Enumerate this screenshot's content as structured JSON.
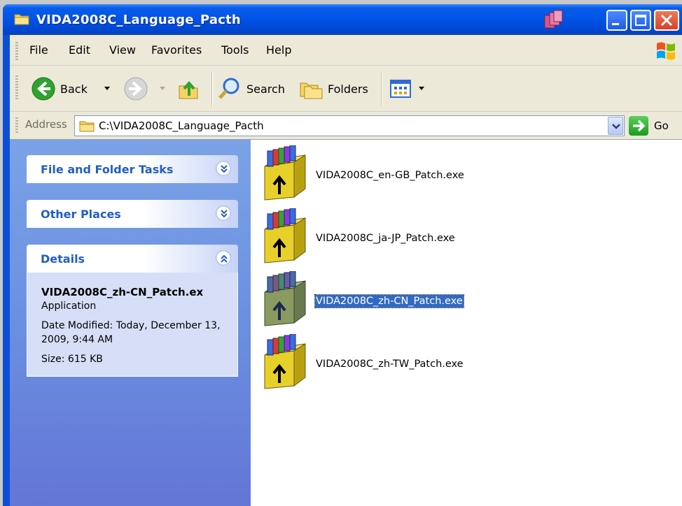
{
  "window": {
    "title": "VIDA2008C_Language_Pacth"
  },
  "menu": [
    "File",
    "Edit",
    "View",
    "Favorites",
    "Tools",
    "Help"
  ],
  "toolbar": {
    "back_label": "Back",
    "search_label": "Search",
    "folders_label": "Folders"
  },
  "address": {
    "label": "Address",
    "value": "C:\\VIDA2008C_Language_Pacth",
    "go_label": "Go"
  },
  "left_pane": {
    "file_folder_tasks": "File and Folder Tasks",
    "other_places": "Other Places",
    "details": {
      "title": "Details",
      "name": "VIDA2008C_zh-CN_Patch.ex",
      "type": "Application",
      "date_modified": "Date Modified: Today, December 13, 2009, 9:44 AM",
      "size": "Size: 615 KB"
    }
  },
  "files": [
    {
      "name": "VIDA2008C_en-GB_Patch.exe",
      "selected": false
    },
    {
      "name": "VIDA2008C_ja-JP_Patch.exe",
      "selected": false
    },
    {
      "name": "VIDA2008C_zh-CN_Patch.exe",
      "selected": true
    },
    {
      "name": "VIDA2008C_zh-TW_Patch.exe",
      "selected": false
    }
  ],
  "colors": {
    "title_bar": "#0053e6",
    "task_pane": "#6b8fe0",
    "selection": "#316ac5",
    "panel_title": "#215dc6"
  }
}
